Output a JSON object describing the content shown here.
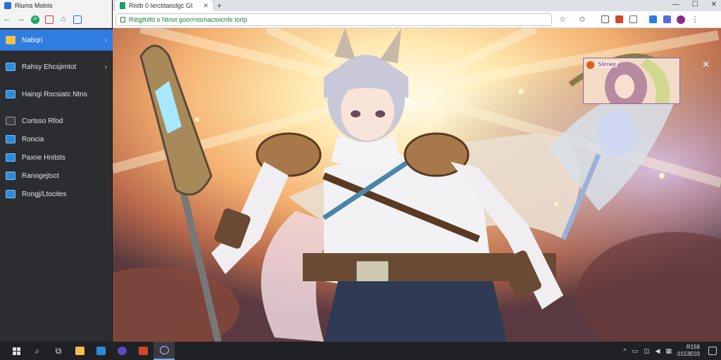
{
  "sidebar": {
    "window_title": "Rlums Mslnis",
    "items": [
      {
        "label": "Nabqri",
        "icon": "folder-icon",
        "active": true,
        "expandable": true
      },
      {
        "label": "Rahsy Ehcsjimtot",
        "icon": "monitor-icon",
        "active": false,
        "expandable": true
      },
      {
        "label": "Haingi Rocsiatc Ntns",
        "icon": "monitor-icon",
        "active": false,
        "expandable": false
      },
      {
        "label": "Cortsso Rfod",
        "icon": "document-icon",
        "active": false,
        "expandable": false
      },
      {
        "label": "Roncia",
        "icon": "monitor-icon",
        "active": false,
        "expandable": false
      },
      {
        "label": "Paxne Hnitsts",
        "icon": "monitor-icon",
        "active": false,
        "expandable": false
      },
      {
        "label": "Ranogejtsct",
        "icon": "monitor-icon",
        "active": false,
        "expandable": false
      },
      {
        "label": "Rongj/Ltocites",
        "icon": "monitor-icon",
        "active": false,
        "expandable": false
      }
    ]
  },
  "browser": {
    "tab_title": "Ristb 0 Ierctitaisdgc Gt",
    "address": "Riitgjfnlfd o Ntnot goorrntsmactoicnfe tortp",
    "popup_label": "Srirneir"
  },
  "taskbar": {
    "clock_time": "R158",
    "clock_date": "0153E03"
  },
  "colors": {
    "accent": "#2f7de1",
    "sidebar_bg": "#2b2d31",
    "taskbar_bg": "#202124"
  }
}
